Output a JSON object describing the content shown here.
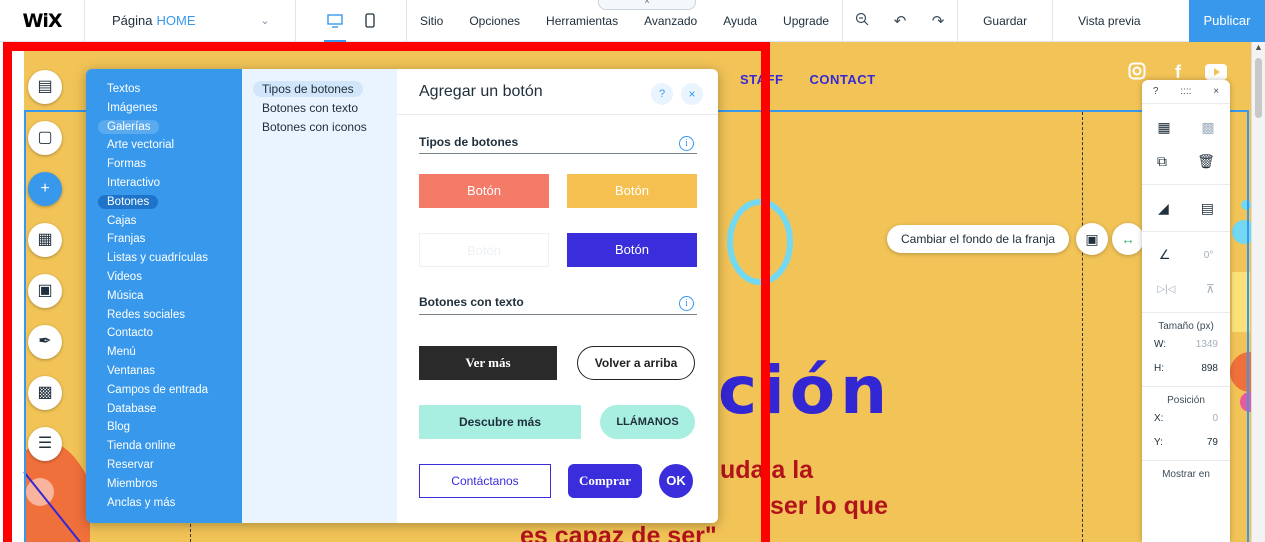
{
  "topbar": {
    "logo": "WiX",
    "page_label": "Página",
    "page_name": "HOME",
    "top_tab_glyph": "^",
    "menu": [
      "Sitio",
      "Opciones",
      "Herramientas",
      "Avanzado",
      "Ayuda",
      "Upgrade"
    ],
    "save": "Guardar",
    "preview": "Vista previa",
    "publish": "Publicar",
    "accent": "#3899ec"
  },
  "site": {
    "nav": [
      "STAFF",
      "CONTACT"
    ],
    "title_fragment": "ción",
    "subtitle_line1": "uda a la",
    "subtitle_line2": "ser lo que",
    "subtitle_line3": "es capaz de ser\"",
    "background_color": "#f2c457",
    "title_color": "#3326d3",
    "subtitle_color": "#b2131b"
  },
  "strip_toolbar": {
    "change_bg": "Cambiar el fondo de la franja"
  },
  "right_panel": {
    "header_help": "?",
    "header_drag": "::::",
    "header_close": "×",
    "angle_value": "0°",
    "size_label": "Tamaño (px)",
    "w_label": "W:",
    "w_value": "1349",
    "h_label": "H:",
    "h_value": "898",
    "position_label": "Posición",
    "x_label": "X:",
    "x_value": "0",
    "y_label": "Y:",
    "y_value": "79",
    "show_on": "Mostrar en"
  },
  "add_panel": {
    "categories": [
      "Textos",
      "Imágenes",
      "Galerías",
      "Arte vectorial",
      "Formas",
      "Interactivo",
      "Botones",
      "Cajas",
      "Franjas",
      "Listas y cuadrículas",
      "Videos",
      "Música",
      "Redes sociales",
      "Contacto",
      "Menú",
      "Ventanas",
      "Campos de entrada",
      "Database",
      "Blog",
      "Tienda online",
      "Reservar",
      "Miembros",
      "Anclas y más"
    ],
    "subcategories": [
      "Tipos de botones",
      "Botones con texto",
      "Botones con iconos"
    ],
    "title": "Agregar un botón",
    "help": "?",
    "close": "×",
    "section1": "Tipos de botones",
    "section2": "Botones con texto",
    "info": "i",
    "type_buttons": [
      "Botón",
      "Botón",
      "Botón",
      "Botón"
    ],
    "text_buttons": [
      "Ver más",
      "Volver a arriba",
      "Descubre más",
      "LLÁMANOS",
      "Contáctanos",
      "Comprar",
      "OK"
    ]
  },
  "colors": {
    "panel_blue": "#3899ec",
    "button_salmon": "#f47b67",
    "button_yellow": "#f5c04f",
    "button_indigo": "#3a2ddb",
    "button_mint": "#a8efe2",
    "button_black": "#2a2a2a"
  },
  "icons": {
    "topbar": [
      "chevron-down-icon",
      "desktop-icon",
      "mobile-icon",
      "zoom-out-icon",
      "undo-icon",
      "redo-icon"
    ],
    "rail": [
      "pages-icon",
      "background-icon",
      "add-icon",
      "apps-icon",
      "media-icon",
      "design-icon",
      "bookings-icon",
      "database-icon"
    ],
    "social": [
      "instagram-icon",
      "facebook-icon",
      "youtube-icon"
    ],
    "strip": [
      "layout-icon",
      "stretch-icon",
      "help-icon",
      "database-icon"
    ],
    "right_panel": [
      "copy-icon",
      "paste-icon",
      "duplicate-icon",
      "delete-icon",
      "arrange-icon",
      "align-icon",
      "rotate-icon",
      "flip-h-icon",
      "flip-v-icon"
    ]
  }
}
